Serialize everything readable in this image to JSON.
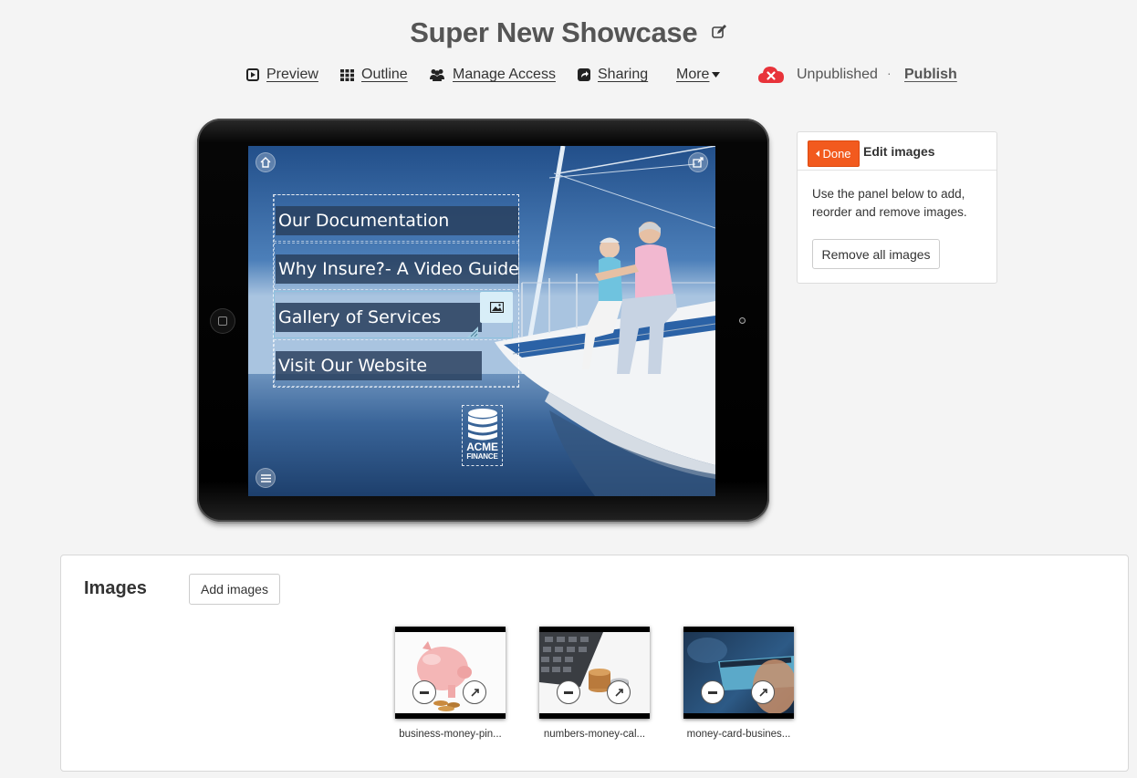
{
  "header": {
    "title": "Super New Showcase",
    "edit_icon": "edit-icon"
  },
  "nav": {
    "preview": "Preview",
    "outline": "Outline",
    "manage_access": "Manage Access",
    "sharing": "Sharing",
    "more": "More",
    "status": "Unpublished",
    "separator": "·",
    "publish": "Publish"
  },
  "screen": {
    "menu_items": [
      "Our Documentation",
      "Why Insure?- A Video Guide",
      "Gallery of Services",
      "Visit Our Website"
    ],
    "logo_line1": "ACME",
    "logo_line2": "FINANCE"
  },
  "panel": {
    "done_label": "Done",
    "title": "Edit images",
    "description": "Use the panel below to add, reorder and remove images.",
    "remove_all_label": "Remove all images"
  },
  "images": {
    "heading": "Images",
    "add_label": "Add images",
    "items": [
      {
        "caption": "business-money-pin..."
      },
      {
        "caption": "numbers-money-cal..."
      },
      {
        "caption": "money-card-busines..."
      }
    ]
  },
  "colors": {
    "accent_orange": "#f25a1e",
    "unpublished_red": "#e8333a",
    "menu_bar": "#283e5c"
  }
}
